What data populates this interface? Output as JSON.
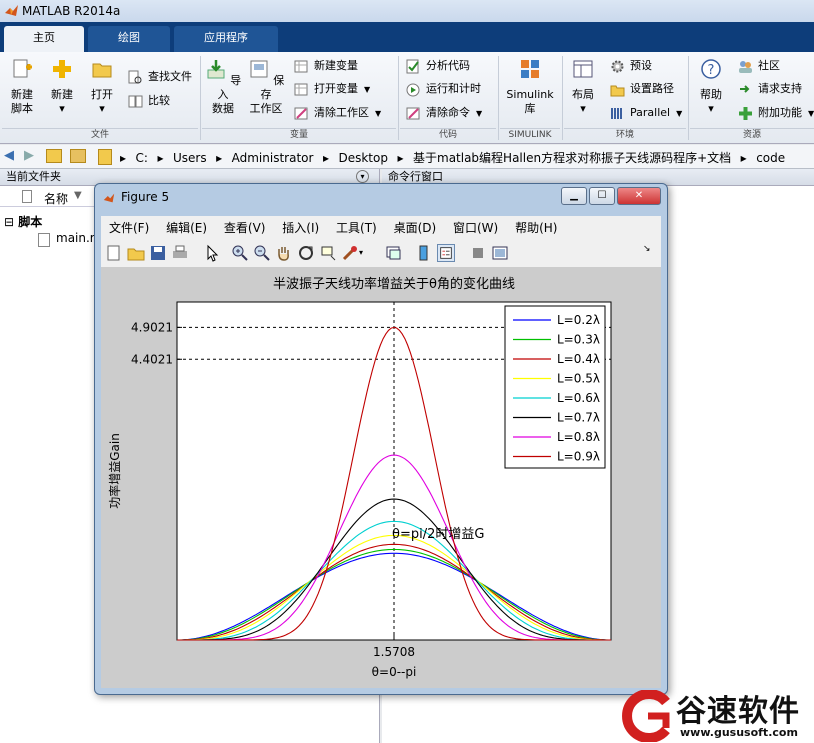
{
  "app": {
    "title": "MATLAB R2014a"
  },
  "tabs": [
    "主页",
    "绘图",
    "应用程序"
  ],
  "ribbon": {
    "file": {
      "label": "文件",
      "new_script": "新建\n脚本",
      "new": "新建",
      "open": "打开",
      "find_files": "查找文件",
      "compare": "比较"
    },
    "variable": {
      "label": "变量",
      "import": "导入\n数据",
      "save_ws": "保存\n工作区",
      "new_var": "新建变量",
      "open_var": "打开变量",
      "clear_ws": "清除工作区"
    },
    "code": {
      "label": "代码",
      "analyze": "分析代码",
      "run_time": "运行和计时",
      "clear_cmd": "清除命令"
    },
    "simulink": {
      "label": "SIMULINK",
      "lib": "Simulink\n库"
    },
    "env": {
      "label": "环境",
      "layout": "布局",
      "prefs": "预设",
      "set_path": "设置路径",
      "parallel": "Parallel"
    },
    "resources": {
      "label": "资源",
      "help": "帮助",
      "community": "社区",
      "support": "请求支持",
      "addons": "附加功能"
    }
  },
  "address": {
    "crumbs": [
      "C:",
      "Users",
      "Administrator",
      "Desktop",
      "基于matlab编程Hallen方程求对称振子天线源码程序+文档",
      "code"
    ]
  },
  "current_folder": {
    "title": "当前文件夹",
    "col_name": "名称",
    "group": "脚本",
    "file": "main.m"
  },
  "command_window": {
    "title": "命令行窗口"
  },
  "figure": {
    "title": "Figure 5",
    "menu": [
      "文件(F)",
      "编辑(E)",
      "查看(V)",
      "插入(I)",
      "工具(T)",
      "桌面(D)",
      "窗口(W)",
      "帮助(H)"
    ]
  },
  "chart_data": {
    "type": "line",
    "title": "半波振子天线功率增益关于θ角的变化曲线",
    "xlabel": "θ=0--pi",
    "ylabel": "功率增益Gain",
    "xlim": [
      0,
      3.1416
    ],
    "ylim": [
      0,
      5.3
    ],
    "x_ticks": [
      1.5708
    ],
    "x_tick_labels": [
      "1.5708"
    ],
    "y_ticks": [
      4.4021,
      4.9021
    ],
    "y_tick_labels": [
      "4.4021",
      "4.9021"
    ],
    "annotation": {
      "text": "θ=pi/2时增益G",
      "x": 1.5708,
      "y": 1.6
    },
    "series": [
      {
        "name": "L=0.2λ",
        "color": "#0000ff",
        "peak": 1.36,
        "exp": 1.0
      },
      {
        "name": "L=0.3λ",
        "color": "#00c000",
        "peak": 1.42,
        "exp": 1.1
      },
      {
        "name": "L=0.4λ",
        "color": "#c00000",
        "peak": 1.5,
        "exp": 1.25
      },
      {
        "name": "L=0.5λ",
        "color": "#ffff00",
        "peak": 1.64,
        "exp": 1.45
      },
      {
        "name": "L=0.6λ",
        "color": "#00d0d0",
        "peak": 1.86,
        "exp": 1.8
      },
      {
        "name": "L=0.7λ",
        "color": "#000000",
        "peak": 2.21,
        "exp": 2.3
      },
      {
        "name": "L=0.8λ",
        "color": "#e000e0",
        "peak": 2.9,
        "exp": 3.3
      },
      {
        "name": "L=0.9λ",
        "color": "#c00000",
        "peak": 4.9021,
        "exp": 6.0
      }
    ],
    "legend": "top-right",
    "grid": "crosshair-at-peak"
  },
  "watermark": {
    "brand": "谷速软件",
    "url": "www.gususoft.com"
  }
}
